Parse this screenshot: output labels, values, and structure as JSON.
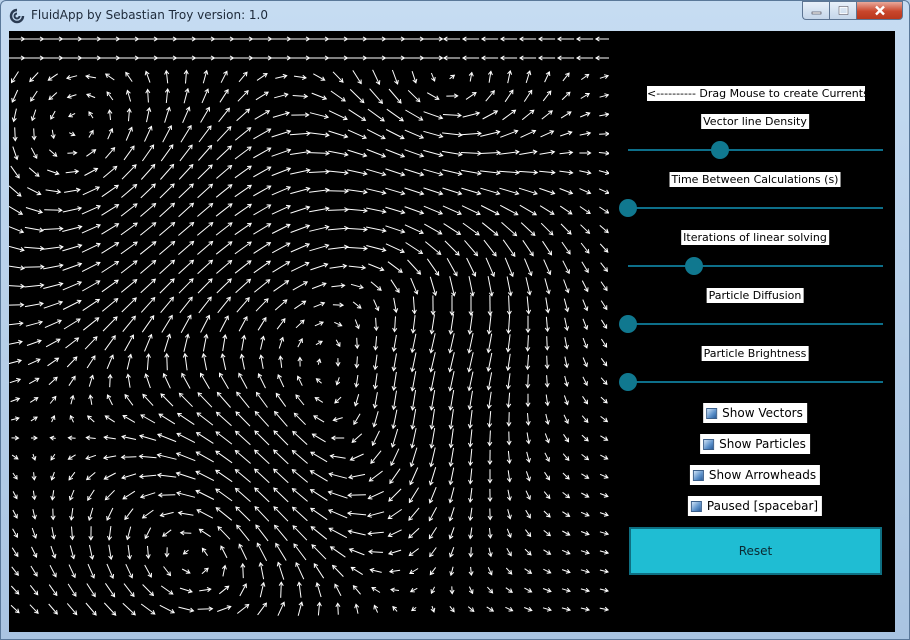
{
  "window": {
    "title": "FluidApp by Sebastian Troy   version: 1.0",
    "controls": [
      "minimize",
      "maximize",
      "close"
    ]
  },
  "sidebar": {
    "instruction": "<---------- Drag Mouse to create Currents",
    "sliders": [
      {
        "label": "Vector line Density",
        "level": 0.36
      },
      {
        "label": "Time Between Calculations (s)",
        "level": 0.0
      },
      {
        "label": "Iterations of linear solving",
        "level": 0.26
      },
      {
        "label": "Particle Diffusion",
        "level": 0.0
      },
      {
        "label": "Particle Brightness",
        "level": 0.0
      }
    ],
    "checkboxes": [
      {
        "label": "Show Vectors"
      },
      {
        "label": "Show Particles"
      },
      {
        "label": "Show Arrowheads"
      },
      {
        "label": "Paused [spacebar]"
      }
    ],
    "reset_label": "Reset"
  },
  "colors": {
    "background": "#000000",
    "vectors": "#ffffff",
    "accent": "#1fbdd3",
    "slider": "#10788f"
  },
  "icons": {
    "app": "fluid-swirl-icon",
    "checkbox": "checkbox-icon"
  }
}
